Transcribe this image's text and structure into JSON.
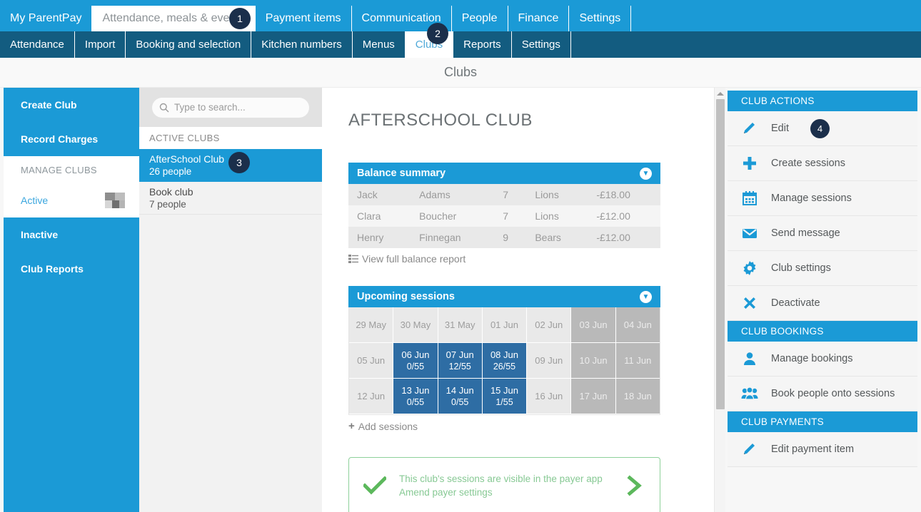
{
  "colors": {
    "primary": "#1b9ad6",
    "subnav": "#135c80",
    "badge": "#1b2f4b",
    "session_active": "#2e6da4",
    "session_off": "#b9b9b9",
    "success": "#8ed19a"
  },
  "topnav": {
    "tabs": [
      {
        "label": "My ParentPay",
        "active": false
      },
      {
        "label": "Attendance, meals & events",
        "active": true
      },
      {
        "label": "Payment items",
        "active": false
      },
      {
        "label": "Communication",
        "active": false
      },
      {
        "label": "People",
        "active": false
      },
      {
        "label": "Finance",
        "active": false
      },
      {
        "label": "Settings",
        "active": false
      }
    ]
  },
  "subnav": {
    "tabs": [
      {
        "label": "Attendance",
        "active": false
      },
      {
        "label": "Import",
        "active": false
      },
      {
        "label": "Booking and selection",
        "active": false
      },
      {
        "label": "Kitchen numbers",
        "active": false
      },
      {
        "label": "Menus",
        "active": false
      },
      {
        "label": "Clubs",
        "active": true
      },
      {
        "label": "Reports",
        "active": false
      },
      {
        "label": "Settings",
        "active": false
      }
    ]
  },
  "page": {
    "title": "Clubs"
  },
  "left_rail": {
    "create_club": "Create Club",
    "record_charges": "Record Charges",
    "manage_clubs_heading": "MANAGE CLUBS",
    "active": "Active",
    "active_count_redacted": "",
    "inactive": "Inactive",
    "club_reports": "Club Reports"
  },
  "club_list": {
    "search_placeholder": "Type to search...",
    "section_heading": "ACTIVE CLUBS",
    "clubs": [
      {
        "name": "AfterSchool Club",
        "people": "26 people",
        "selected": true
      },
      {
        "name": "Book club",
        "people": "7 people",
        "selected": false
      }
    ]
  },
  "main": {
    "heading": "AFTERSCHOOL CLUB",
    "balance": {
      "title": "Balance summary",
      "rows": [
        {
          "first": "Jack",
          "last": "Adams",
          "year": "7",
          "group": "Lions",
          "amount": "-£18.00"
        },
        {
          "first": "Clara",
          "last": "Boucher",
          "year": "7",
          "group": "Lions",
          "amount": "-£12.00"
        },
        {
          "first": "Henry",
          "last": "Finnegan",
          "year": "9",
          "group": "Bears",
          "amount": "-£12.00"
        }
      ],
      "report_link": "View full balance report"
    },
    "sessions": {
      "title": "Upcoming sessions",
      "add_link": "Add sessions",
      "weeks": [
        [
          {
            "date": "29 May",
            "state": "plain",
            "count": ""
          },
          {
            "date": "30 May",
            "state": "plain",
            "count": ""
          },
          {
            "date": "31 May",
            "state": "plain",
            "count": ""
          },
          {
            "date": "01 Jun",
            "state": "plain",
            "count": ""
          },
          {
            "date": "02 Jun",
            "state": "plain",
            "count": ""
          },
          {
            "date": "03 Jun",
            "state": "off",
            "count": ""
          },
          {
            "date": "04 Jun",
            "state": "off",
            "count": ""
          }
        ],
        [
          {
            "date": "05 Jun",
            "state": "plain",
            "count": ""
          },
          {
            "date": "06 Jun",
            "state": "on",
            "count": "0/55"
          },
          {
            "date": "07 Jun",
            "state": "on",
            "count": "12/55"
          },
          {
            "date": "08 Jun",
            "state": "on",
            "count": "26/55"
          },
          {
            "date": "09 Jun",
            "state": "plain",
            "count": ""
          },
          {
            "date": "10 Jun",
            "state": "off",
            "count": ""
          },
          {
            "date": "11 Jun",
            "state": "off",
            "count": ""
          }
        ],
        [
          {
            "date": "12 Jun",
            "state": "plain",
            "count": ""
          },
          {
            "date": "13 Jun",
            "state": "on",
            "count": "0/55"
          },
          {
            "date": "14 Jun",
            "state": "on",
            "count": "0/55"
          },
          {
            "date": "15 Jun",
            "state": "on",
            "count": "1/55"
          },
          {
            "date": "16 Jun",
            "state": "plain",
            "count": ""
          },
          {
            "date": "17 Jun",
            "state": "off",
            "count": ""
          },
          {
            "date": "18 Jun",
            "state": "off",
            "count": ""
          }
        ]
      ]
    },
    "notice": {
      "line1": "This club's sessions are visible in the payer app",
      "line2": "Amend payer settings"
    }
  },
  "actions": {
    "club_actions_heading": "CLUB ACTIONS",
    "club_actions": [
      {
        "label": "Edit",
        "icon": "pencil-icon"
      },
      {
        "label": "Create sessions",
        "icon": "plus-icon"
      },
      {
        "label": "Manage sessions",
        "icon": "calendar-icon"
      },
      {
        "label": "Send message",
        "icon": "envelope-icon"
      },
      {
        "label": "Club settings",
        "icon": "gear-icon"
      },
      {
        "label": "Deactivate",
        "icon": "cross-icon"
      }
    ],
    "club_bookings_heading": "CLUB BOOKINGS",
    "club_bookings": [
      {
        "label": "Manage bookings",
        "icon": "person-icon"
      },
      {
        "label": "Book people onto sessions",
        "icon": "people-icon"
      }
    ],
    "club_payments_heading": "CLUB PAYMENTS",
    "club_payments": [
      {
        "label": "Edit payment item",
        "icon": "pencil-icon"
      }
    ]
  },
  "badges": {
    "b1": "1",
    "b2": "2",
    "b3": "3",
    "b4": "4"
  }
}
